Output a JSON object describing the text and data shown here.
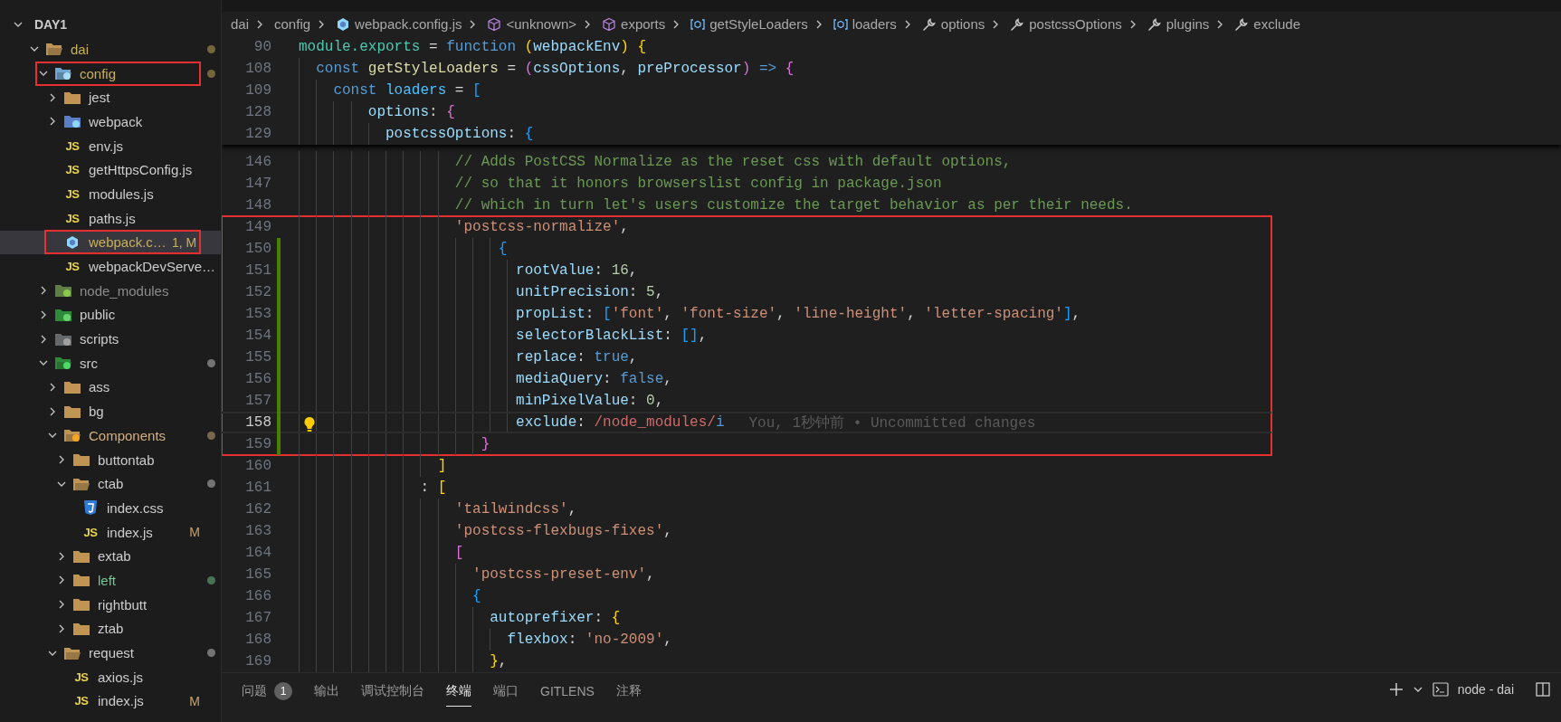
{
  "explorer": {
    "title": "DAY1",
    "expanded": true,
    "items": [
      {
        "name": "dai",
        "kind": "folder",
        "expanded": true,
        "selected": false,
        "annotated": false,
        "color": "#c9b05a",
        "dot": true,
        "children": [
          {
            "name": "config",
            "kind": "config",
            "expanded": true,
            "selected": false,
            "annotated": true,
            "color": "#c9b05a",
            "dot": true,
            "children": [
              {
                "name": "jest",
                "kind": "folder",
                "expanded": false,
                "selected": false,
                "annotated": false,
                "color": "#cccccc",
                "dot": false
              },
              {
                "name": "webpack",
                "kind": "webpack",
                "expanded": false,
                "selected": false,
                "annotated": false,
                "color": "#cccccc",
                "dot": false
              },
              {
                "name": "env.js",
                "kind": "js",
                "icon_label": "JS",
                "selected": false,
                "annotated": false,
                "color": "#cccccc"
              },
              {
                "name": "getHttpsConfig.js",
                "kind": "js",
                "icon_label": "JS",
                "selected": false,
                "annotated": false,
                "color": "#cccccc"
              },
              {
                "name": "modules.js",
                "kind": "js",
                "icon_label": "JS",
                "selected": false,
                "annotated": false,
                "color": "#cccccc"
              },
              {
                "name": "paths.js",
                "kind": "js",
                "icon_label": "JS",
                "selected": false,
                "annotated": false,
                "color": "#cccccc"
              },
              {
                "name": "webpack.c…",
                "kind": "hexagon",
                "selected": true,
                "annotated": true,
                "color": "#c9b05a",
                "badge": "1, M"
              },
              {
                "name": "webpackDevServe…",
                "kind": "js",
                "icon_label": "JS",
                "selected": false,
                "annotated": false,
                "color": "#cccccc"
              }
            ]
          },
          {
            "name": "node_modules",
            "kind": "node",
            "expanded": false,
            "selected": false,
            "annotated": false,
            "color": "#8c8c8c",
            "dot": false
          },
          {
            "name": "public",
            "kind": "public",
            "expanded": false,
            "selected": false,
            "annotated": false,
            "color": "#cccccc",
            "dot": false
          },
          {
            "name": "scripts",
            "kind": "scripts",
            "expanded": false,
            "selected": false,
            "annotated": false,
            "color": "#cccccc",
            "dot": false
          },
          {
            "name": "src",
            "kind": "src",
            "expanded": true,
            "selected": false,
            "annotated": false,
            "color": "#cccccc",
            "dot": true,
            "children": [
              {
                "name": "ass",
                "kind": "folder",
                "expanded": false,
                "selected": false,
                "annotated": false,
                "color": "#cccccc",
                "dot": false
              },
              {
                "name": "bg",
                "kind": "folder",
                "expanded": false,
                "selected": false,
                "annotated": false,
                "color": "#cccccc",
                "dot": false
              },
              {
                "name": "Components",
                "kind": "components",
                "expanded": true,
                "selected": false,
                "annotated": false,
                "color": "#d7b07d",
                "dot": true,
                "children": [
                  {
                    "name": "buttontab",
                    "kind": "folder",
                    "expanded": false,
                    "selected": false,
                    "annotated": false,
                    "color": "#cccccc",
                    "dot": false
                  },
                  {
                    "name": "ctab",
                    "kind": "folder",
                    "expanded": true,
                    "selected": false,
                    "annotated": false,
                    "color": "#cccccc",
                    "dot": true,
                    "children": [
                      {
                        "name": "index.css",
                        "kind": "css",
                        "selected": false,
                        "annotated": false,
                        "color": "#cccccc"
                      },
                      {
                        "name": "index.js",
                        "kind": "js",
                        "icon_label": "JS",
                        "selected": false,
                        "annotated": false,
                        "color": "#cccccc",
                        "badge": "M"
                      }
                    ]
                  },
                  {
                    "name": "extab",
                    "kind": "folder",
                    "expanded": false,
                    "selected": false,
                    "annotated": false,
                    "color": "#cccccc",
                    "dot": false
                  },
                  {
                    "name": "left",
                    "kind": "folder",
                    "expanded": false,
                    "selected": false,
                    "annotated": false,
                    "color": "#73c991",
                    "dot": true
                  },
                  {
                    "name": "rightbutt",
                    "kind": "folder",
                    "expanded": false,
                    "selected": false,
                    "annotated": false,
                    "color": "#cccccc",
                    "dot": false
                  },
                  {
                    "name": "ztab",
                    "kind": "folder",
                    "expanded": false,
                    "selected": false,
                    "annotated": false,
                    "color": "#cccccc",
                    "dot": false
                  }
                ]
              },
              {
                "name": "request",
                "kind": "folder",
                "expanded": true,
                "selected": false,
                "annotated": false,
                "color": "#cccccc",
                "dot": true,
                "children": [
                  {
                    "name": "axios.js",
                    "kind": "js",
                    "icon_label": "JS",
                    "selected": false,
                    "annotated": false,
                    "color": "#cccccc"
                  },
                  {
                    "name": "index.js",
                    "kind": "js",
                    "icon_label": "JS",
                    "selected": false,
                    "annotated": false,
                    "color": "#cccccc",
                    "badge": "M"
                  }
                ]
              }
            ]
          }
        ]
      }
    ]
  },
  "breadcrumbs": [
    {
      "label": "dai",
      "kind": "plain"
    },
    {
      "label": "config",
      "kind": "plain"
    },
    {
      "label": "webpack.config.js",
      "kind": "file"
    },
    {
      "label": "<unknown>",
      "kind": "module"
    },
    {
      "label": "exports",
      "kind": "module"
    },
    {
      "label": "getStyleLoaders",
      "kind": "variable"
    },
    {
      "label": "loaders",
      "kind": "variable"
    },
    {
      "label": "options",
      "kind": "property"
    },
    {
      "label": "postcssOptions",
      "kind": "property"
    },
    {
      "label": "plugins",
      "kind": "property"
    },
    {
      "label": "exclude",
      "kind": "property"
    }
  ],
  "editor": {
    "sticky_lines": [
      {
        "number": "90",
        "tokens": [
          {
            "kind": "mod",
            "text": "module.exports"
          },
          {
            "kind": "p",
            "text": " = "
          },
          {
            "kind": "kw",
            "text": "function "
          },
          {
            "kind": "b1",
            "text": "("
          },
          {
            "kind": "var",
            "text": "webpackEnv"
          },
          {
            "kind": "b1",
            "text": ") "
          },
          {
            "kind": "b1",
            "text": "{"
          }
        ]
      },
      {
        "number": "108",
        "tokens": [
          {
            "kind": "kw",
            "text": "  const "
          },
          {
            "kind": "fn",
            "text": "getStyleLoaders"
          },
          {
            "kind": "p",
            "text": " = "
          },
          {
            "kind": "b2",
            "text": "("
          },
          {
            "kind": "var",
            "text": "cssOptions"
          },
          {
            "kind": "p",
            "text": ", "
          },
          {
            "kind": "var",
            "text": "preProcessor"
          },
          {
            "kind": "b2",
            "text": ") "
          },
          {
            "kind": "kw",
            "text": "=> "
          },
          {
            "kind": "b2",
            "text": "{"
          }
        ]
      },
      {
        "number": "109",
        "tokens": [
          {
            "kind": "kw",
            "text": "    const "
          },
          {
            "kind": "cvar",
            "text": "loaders"
          },
          {
            "kind": "p",
            "text": " = "
          },
          {
            "kind": "b3",
            "text": "["
          }
        ]
      },
      {
        "number": "128",
        "tokens": [
          {
            "kind": "var",
            "text": "        options"
          },
          {
            "kind": "p",
            "text": ": "
          },
          {
            "kind": "b2",
            "text": "{"
          }
        ]
      },
      {
        "number": "129",
        "tokens": [
          {
            "kind": "var",
            "text": "          postcssOptions"
          },
          {
            "kind": "p",
            "text": ": "
          },
          {
            "kind": "b3",
            "text": "{"
          }
        ]
      }
    ],
    "lines": [
      {
        "number": "146",
        "current": false,
        "changed": false,
        "boxed": false,
        "tokens": [
          {
            "kind": "cmt",
            "text": "                  // Adds PostCSS Normalize as the reset css with default options,"
          }
        ]
      },
      {
        "number": "147",
        "current": false,
        "changed": false,
        "boxed": false,
        "tokens": [
          {
            "kind": "cmt",
            "text": "                  // so that it honors browserslist config in package.json"
          }
        ]
      },
      {
        "number": "148",
        "current": false,
        "changed": false,
        "boxed": false,
        "tokens": [
          {
            "kind": "cmt",
            "text": "                  // which in turn let's users customize the target behavior as per their needs."
          }
        ]
      },
      {
        "number": "149",
        "current": false,
        "changed": false,
        "boxed": true,
        "tokens": [
          {
            "kind": "str",
            "text": "                  'postcss-normalize'"
          },
          {
            "kind": "p",
            "text": ","
          }
        ]
      },
      {
        "number": "150",
        "current": false,
        "changed": true,
        "boxed": true,
        "tokens": [
          {
            "kind": "b3",
            "text": "                       {"
          }
        ]
      },
      {
        "number": "151",
        "current": false,
        "changed": true,
        "boxed": true,
        "tokens": [
          {
            "kind": "var",
            "text": "                         rootValue"
          },
          {
            "kind": "p",
            "text": ": "
          },
          {
            "kind": "num",
            "text": "16"
          },
          {
            "kind": "p",
            "text": ","
          }
        ]
      },
      {
        "number": "152",
        "current": false,
        "changed": true,
        "boxed": true,
        "tokens": [
          {
            "kind": "var",
            "text": "                         unitPrecision"
          },
          {
            "kind": "p",
            "text": ": "
          },
          {
            "kind": "num",
            "text": "5"
          },
          {
            "kind": "p",
            "text": ","
          }
        ]
      },
      {
        "number": "153",
        "current": false,
        "changed": true,
        "boxed": true,
        "tokens": [
          {
            "kind": "var",
            "text": "                         propList"
          },
          {
            "kind": "p",
            "text": ": "
          },
          {
            "kind": "b3",
            "text": "["
          },
          {
            "kind": "str",
            "text": "'font'"
          },
          {
            "kind": "p",
            "text": ", "
          },
          {
            "kind": "str",
            "text": "'font-size'"
          },
          {
            "kind": "p",
            "text": ", "
          },
          {
            "kind": "str",
            "text": "'line-height'"
          },
          {
            "kind": "p",
            "text": ", "
          },
          {
            "kind": "str",
            "text": "'letter-spacing'"
          },
          {
            "kind": "b3",
            "text": "]"
          },
          {
            "kind": "p",
            "text": ","
          }
        ]
      },
      {
        "number": "154",
        "current": false,
        "changed": true,
        "boxed": true,
        "tokens": [
          {
            "kind": "var",
            "text": "                         selectorBlackList"
          },
          {
            "kind": "p",
            "text": ": "
          },
          {
            "kind": "b3",
            "text": "[]"
          },
          {
            "kind": "p",
            "text": ","
          }
        ]
      },
      {
        "number": "155",
        "current": false,
        "changed": true,
        "boxed": true,
        "tokens": [
          {
            "kind": "var",
            "text": "                         replace"
          },
          {
            "kind": "p",
            "text": ": "
          },
          {
            "kind": "kw",
            "text": "true"
          },
          {
            "kind": "p",
            "text": ","
          }
        ]
      },
      {
        "number": "156",
        "current": false,
        "changed": true,
        "boxed": true,
        "tokens": [
          {
            "kind": "var",
            "text": "                         mediaQuery"
          },
          {
            "kind": "p",
            "text": ": "
          },
          {
            "kind": "kw",
            "text": "false"
          },
          {
            "kind": "p",
            "text": ","
          }
        ]
      },
      {
        "number": "157",
        "current": false,
        "changed": true,
        "boxed": true,
        "tokens": [
          {
            "kind": "var",
            "text": "                         minPixelValue"
          },
          {
            "kind": "p",
            "text": ": "
          },
          {
            "kind": "num",
            "text": "0"
          },
          {
            "kind": "p",
            "text": ","
          }
        ]
      },
      {
        "number": "158",
        "current": true,
        "changed": true,
        "boxed": true,
        "blame": "You, 1秒钟前 • Uncommitted changes",
        "tokens": [
          {
            "kind": "var",
            "text": "                         exclude"
          },
          {
            "kind": "p",
            "text": ": "
          },
          {
            "kind": "re",
            "text": "/node_modules/"
          },
          {
            "kind": "kw",
            "text": "i"
          }
        ]
      },
      {
        "number": "159",
        "current": false,
        "changed": true,
        "boxed": true,
        "tokens": [
          {
            "kind": "b2",
            "text": "                     }"
          }
        ]
      },
      {
        "number": "160",
        "current": false,
        "changed": false,
        "boxed": false,
        "tokens": [
          {
            "kind": "b1",
            "text": "                ]"
          }
        ]
      },
      {
        "number": "161",
        "current": false,
        "changed": false,
        "boxed": false,
        "tokens": [
          {
            "kind": "p",
            "text": "              : "
          },
          {
            "kind": "b1",
            "text": "["
          }
        ]
      },
      {
        "number": "162",
        "current": false,
        "changed": false,
        "boxed": false,
        "tokens": [
          {
            "kind": "str",
            "text": "                  'tailwindcss'"
          },
          {
            "kind": "p",
            "text": ","
          }
        ]
      },
      {
        "number": "163",
        "current": false,
        "changed": false,
        "boxed": false,
        "tokens": [
          {
            "kind": "str",
            "text": "                  'postcss-flexbugs-fixes'"
          },
          {
            "kind": "p",
            "text": ","
          }
        ]
      },
      {
        "number": "164",
        "current": false,
        "changed": false,
        "boxed": false,
        "tokens": [
          {
            "kind": "b2",
            "text": "                  ["
          }
        ]
      },
      {
        "number": "165",
        "current": false,
        "changed": false,
        "boxed": false,
        "tokens": [
          {
            "kind": "str",
            "text": "                    'postcss-preset-env'"
          },
          {
            "kind": "p",
            "text": ","
          }
        ]
      },
      {
        "number": "166",
        "current": false,
        "changed": false,
        "boxed": false,
        "tokens": [
          {
            "kind": "b3",
            "text": "                    {"
          }
        ]
      },
      {
        "number": "167",
        "current": false,
        "changed": false,
        "boxed": false,
        "tokens": [
          {
            "kind": "var",
            "text": "                      autoprefixer"
          },
          {
            "kind": "p",
            "text": ": "
          },
          {
            "kind": "b1",
            "text": "{"
          }
        ]
      },
      {
        "number": "168",
        "current": false,
        "changed": false,
        "boxed": false,
        "tokens": [
          {
            "kind": "var",
            "text": "                        flexbox"
          },
          {
            "kind": "p",
            "text": ": "
          },
          {
            "kind": "str",
            "text": "'no-2009'"
          },
          {
            "kind": "p",
            "text": ","
          }
        ]
      },
      {
        "number": "169",
        "current": false,
        "changed": false,
        "boxed": false,
        "tokens": [
          {
            "kind": "b1",
            "text": "                      }"
          },
          {
            "kind": "p",
            "text": ","
          }
        ]
      }
    ]
  },
  "panel": {
    "tabs": [
      {
        "label": "问题",
        "badge": "1",
        "selected": false
      },
      {
        "label": "输出",
        "selected": false
      },
      {
        "label": "调试控制台",
        "selected": false
      },
      {
        "label": "终端",
        "selected": true
      },
      {
        "label": "端口",
        "selected": false
      },
      {
        "label": "GITLENS",
        "selected": false
      },
      {
        "label": "注释",
        "selected": false
      }
    ],
    "terminal": "node - dai"
  }
}
